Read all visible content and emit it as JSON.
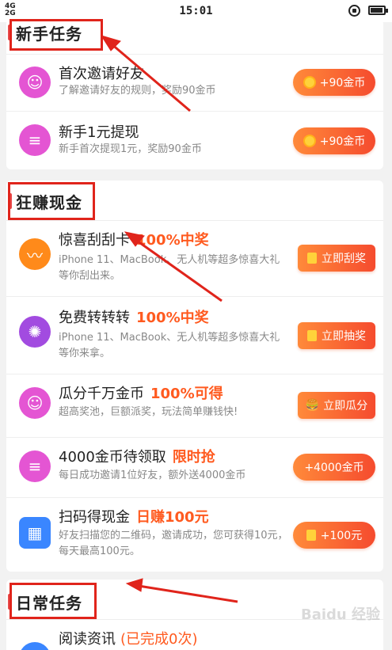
{
  "status_bar": {
    "signal_top": "4G",
    "signal_bottom": "2G",
    "time": "15:01"
  },
  "sections": {
    "newbie": {
      "title": "新手任务"
    },
    "earn": {
      "title": "狂赚现金"
    },
    "daily": {
      "title": "日常任务"
    }
  },
  "newbie_rows": [
    {
      "title": "首次邀请好友",
      "sub": "了解邀请好友的规则，奖励90金币",
      "button": "+90金币",
      "icon_color": "#e455d3"
    },
    {
      "title": "新手1元提现",
      "sub": "新手首次提现1元，奖励90金币",
      "button": "+90金币",
      "icon_color": "#e455d3"
    }
  ],
  "earn_rows": [
    {
      "title": "惊喜刮刮卡",
      "accent": "100%中奖",
      "sub": "iPhone 11、MacBook、无人机等超多惊喜大礼等你刮出来。",
      "button": "立即刮奖",
      "icon_color": "#ff8a1a"
    },
    {
      "title": "免费转转转",
      "accent": "100%中奖",
      "sub": "iPhone 11、MacBook、无人机等超多惊喜大礼等你来拿。",
      "button": "立即抽奖",
      "icon_color": "#a24be0"
    },
    {
      "title": "瓜分千万金币",
      "accent": "100%可得",
      "sub": "超高奖池，巨额派奖，玩法简单赚钱快!",
      "button": "立即瓜分",
      "icon_color": "#e455d3"
    },
    {
      "title": "4000金币待领取",
      "accent": "限时抢",
      "sub": "每日成功邀请1位好友，额外送4000金币",
      "button": "+4000金币",
      "icon_color": "#e455d3"
    },
    {
      "title": "扫码得现金",
      "accent": "日赚100元",
      "sub": "好友扫描您的二维码，邀请成功，您可获得10元，每天最高100元。",
      "button": "+100元",
      "icon_color": "#3a86ff"
    }
  ],
  "daily_rows": [
    {
      "title": "阅读资讯",
      "accent": "(已完成0次)",
      "icon_color": "#3a86ff"
    }
  ],
  "watermark": "Baidu 经验",
  "colors": {
    "accent": "#ff5a1f",
    "annotation_red": "#e0241b",
    "button_gradient_start": "#ff8a3a",
    "button_gradient_end": "#f54b2e"
  }
}
